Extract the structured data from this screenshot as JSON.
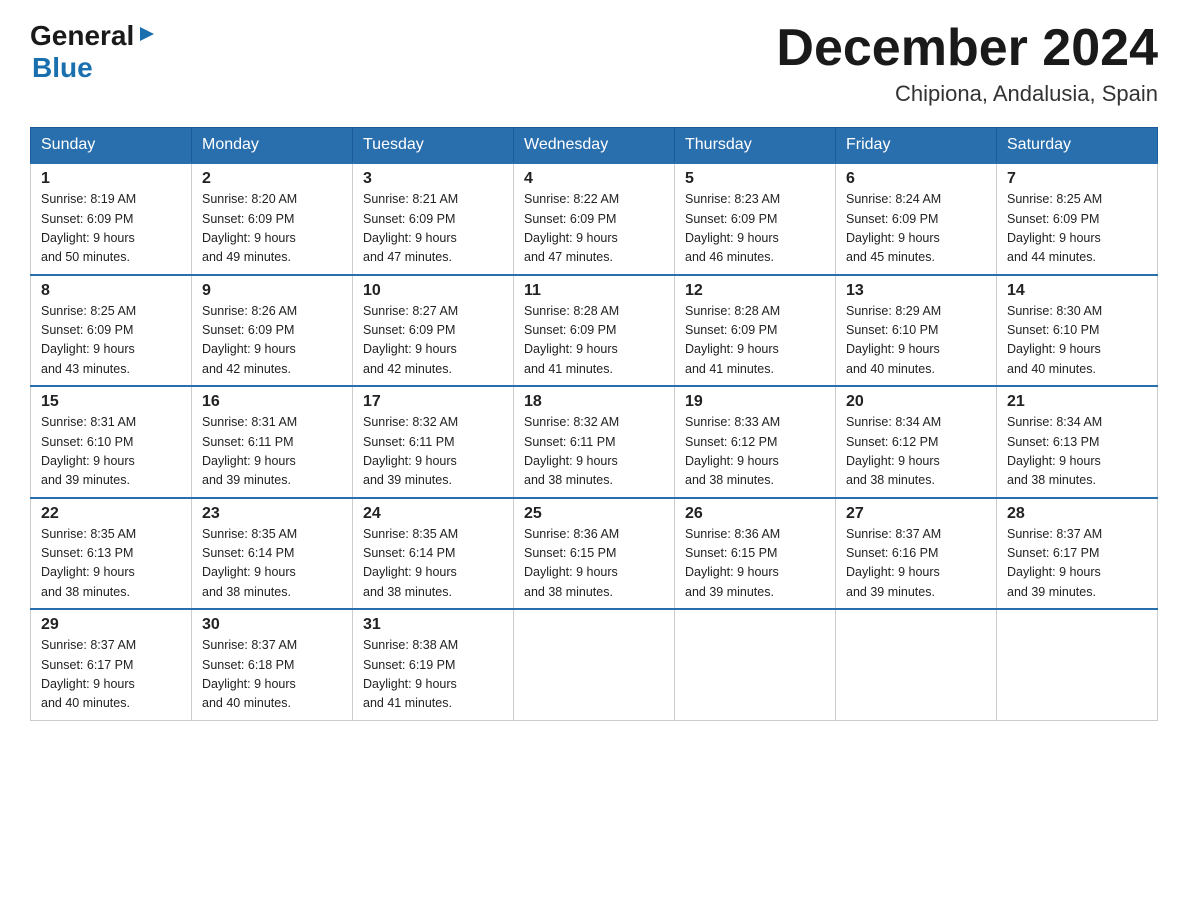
{
  "logo": {
    "text_black": "General",
    "text_blue": "Blue",
    "arrow_unicode": "▶"
  },
  "title": "December 2024",
  "subtitle": "Chipiona, Andalusia, Spain",
  "headers": [
    "Sunday",
    "Monday",
    "Tuesday",
    "Wednesday",
    "Thursday",
    "Friday",
    "Saturday"
  ],
  "weeks": [
    [
      {
        "day": "1",
        "sunrise": "8:19 AM",
        "sunset": "6:09 PM",
        "daylight": "9 hours and 50 minutes."
      },
      {
        "day": "2",
        "sunrise": "8:20 AM",
        "sunset": "6:09 PM",
        "daylight": "9 hours and 49 minutes."
      },
      {
        "day": "3",
        "sunrise": "8:21 AM",
        "sunset": "6:09 PM",
        "daylight": "9 hours and 47 minutes."
      },
      {
        "day": "4",
        "sunrise": "8:22 AM",
        "sunset": "6:09 PM",
        "daylight": "9 hours and 47 minutes."
      },
      {
        "day": "5",
        "sunrise": "8:23 AM",
        "sunset": "6:09 PM",
        "daylight": "9 hours and 46 minutes."
      },
      {
        "day": "6",
        "sunrise": "8:24 AM",
        "sunset": "6:09 PM",
        "daylight": "9 hours and 45 minutes."
      },
      {
        "day": "7",
        "sunrise": "8:25 AM",
        "sunset": "6:09 PM",
        "daylight": "9 hours and 44 minutes."
      }
    ],
    [
      {
        "day": "8",
        "sunrise": "8:25 AM",
        "sunset": "6:09 PM",
        "daylight": "9 hours and 43 minutes."
      },
      {
        "day": "9",
        "sunrise": "8:26 AM",
        "sunset": "6:09 PM",
        "daylight": "9 hours and 42 minutes."
      },
      {
        "day": "10",
        "sunrise": "8:27 AM",
        "sunset": "6:09 PM",
        "daylight": "9 hours and 42 minutes."
      },
      {
        "day": "11",
        "sunrise": "8:28 AM",
        "sunset": "6:09 PM",
        "daylight": "9 hours and 41 minutes."
      },
      {
        "day": "12",
        "sunrise": "8:28 AM",
        "sunset": "6:09 PM",
        "daylight": "9 hours and 41 minutes."
      },
      {
        "day": "13",
        "sunrise": "8:29 AM",
        "sunset": "6:10 PM",
        "daylight": "9 hours and 40 minutes."
      },
      {
        "day": "14",
        "sunrise": "8:30 AM",
        "sunset": "6:10 PM",
        "daylight": "9 hours and 40 minutes."
      }
    ],
    [
      {
        "day": "15",
        "sunrise": "8:31 AM",
        "sunset": "6:10 PM",
        "daylight": "9 hours and 39 minutes."
      },
      {
        "day": "16",
        "sunrise": "8:31 AM",
        "sunset": "6:11 PM",
        "daylight": "9 hours and 39 minutes."
      },
      {
        "day": "17",
        "sunrise": "8:32 AM",
        "sunset": "6:11 PM",
        "daylight": "9 hours and 39 minutes."
      },
      {
        "day": "18",
        "sunrise": "8:32 AM",
        "sunset": "6:11 PM",
        "daylight": "9 hours and 38 minutes."
      },
      {
        "day": "19",
        "sunrise": "8:33 AM",
        "sunset": "6:12 PM",
        "daylight": "9 hours and 38 minutes."
      },
      {
        "day": "20",
        "sunrise": "8:34 AM",
        "sunset": "6:12 PM",
        "daylight": "9 hours and 38 minutes."
      },
      {
        "day": "21",
        "sunrise": "8:34 AM",
        "sunset": "6:13 PM",
        "daylight": "9 hours and 38 minutes."
      }
    ],
    [
      {
        "day": "22",
        "sunrise": "8:35 AM",
        "sunset": "6:13 PM",
        "daylight": "9 hours and 38 minutes."
      },
      {
        "day": "23",
        "sunrise": "8:35 AM",
        "sunset": "6:14 PM",
        "daylight": "9 hours and 38 minutes."
      },
      {
        "day": "24",
        "sunrise": "8:35 AM",
        "sunset": "6:14 PM",
        "daylight": "9 hours and 38 minutes."
      },
      {
        "day": "25",
        "sunrise": "8:36 AM",
        "sunset": "6:15 PM",
        "daylight": "9 hours and 38 minutes."
      },
      {
        "day": "26",
        "sunrise": "8:36 AM",
        "sunset": "6:15 PM",
        "daylight": "9 hours and 39 minutes."
      },
      {
        "day": "27",
        "sunrise": "8:37 AM",
        "sunset": "6:16 PM",
        "daylight": "9 hours and 39 minutes."
      },
      {
        "day": "28",
        "sunrise": "8:37 AM",
        "sunset": "6:17 PM",
        "daylight": "9 hours and 39 minutes."
      }
    ],
    [
      {
        "day": "29",
        "sunrise": "8:37 AM",
        "sunset": "6:17 PM",
        "daylight": "9 hours and 40 minutes."
      },
      {
        "day": "30",
        "sunrise": "8:37 AM",
        "sunset": "6:18 PM",
        "daylight": "9 hours and 40 minutes."
      },
      {
        "day": "31",
        "sunrise": "8:38 AM",
        "sunset": "6:19 PM",
        "daylight": "9 hours and 41 minutes."
      },
      null,
      null,
      null,
      null
    ]
  ],
  "labels": {
    "sunrise": "Sunrise:",
    "sunset": "Sunset:",
    "daylight": "Daylight:"
  }
}
